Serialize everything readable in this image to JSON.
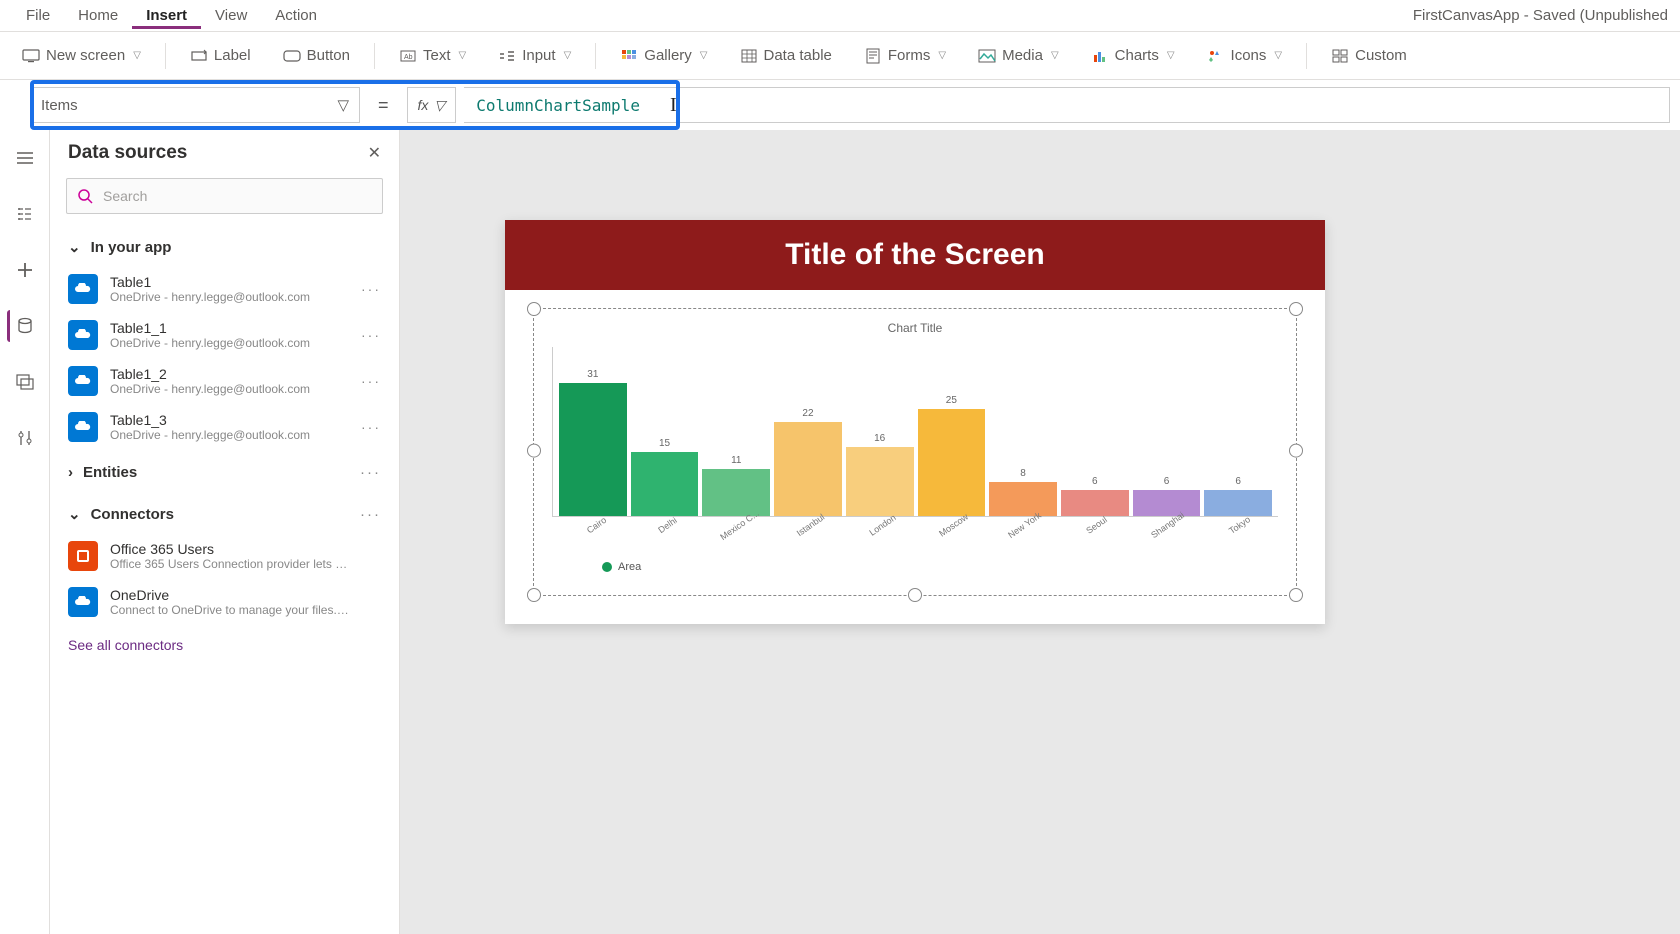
{
  "app_title": "FirstCanvasApp - Saved (Unpublished",
  "menu": {
    "file": "File",
    "home": "Home",
    "insert": "Insert",
    "view": "View",
    "action": "Action"
  },
  "ribbon": {
    "new_screen": "New screen",
    "label": "Label",
    "button": "Button",
    "text": "Text",
    "input": "Input",
    "gallery": "Gallery",
    "data_table": "Data table",
    "forms": "Forms",
    "media": "Media",
    "charts": "Charts",
    "icons": "Icons",
    "custom": "Custom"
  },
  "formula": {
    "property": "Items",
    "fx": "fx",
    "value": "ColumnChartSample"
  },
  "panel": {
    "title": "Data sources",
    "search_placeholder": "Search",
    "in_your_app": "In your app",
    "entities": "Entities",
    "connectors": "Connectors",
    "see_all": "See all connectors"
  },
  "data_sources": [
    {
      "name": "Table1",
      "sub": "OneDrive - henry.legge@outlook.com"
    },
    {
      "name": "Table1_1",
      "sub": "OneDrive - henry.legge@outlook.com"
    },
    {
      "name": "Table1_2",
      "sub": "OneDrive - henry.legge@outlook.com"
    },
    {
      "name": "Table1_3",
      "sub": "OneDrive - henry.legge@outlook.com"
    }
  ],
  "connectors": [
    {
      "name": "Office 365 Users",
      "sub": "Office 365 Users Connection provider lets you ..."
    },
    {
      "name": "OneDrive",
      "sub": "Connect to OneDrive to manage your files. Yo..."
    }
  ],
  "screen": {
    "title": "Title of the Screen",
    "chart_title": "Chart Title",
    "legend": "Area"
  },
  "chart_data": {
    "type": "bar",
    "title": "Chart Title",
    "xlabel": "",
    "ylabel": "",
    "ylim": [
      0,
      35
    ],
    "legend": "Area",
    "categories": [
      "Cairo",
      "Delhi",
      "Mexico C...",
      "Istanbul",
      "London",
      "Moscow",
      "New York",
      "Seoul",
      "Shanghai",
      "Tokyo"
    ],
    "values": [
      31,
      15,
      11,
      22,
      16,
      25,
      8,
      6,
      6,
      6
    ],
    "colors": [
      "#159957",
      "#2fb36f",
      "#62c185",
      "#f6c46b",
      "#f8ce7d",
      "#f6b93b",
      "#f49a5a",
      "#e88a82",
      "#b48bd2",
      "#8aade0"
    ]
  }
}
